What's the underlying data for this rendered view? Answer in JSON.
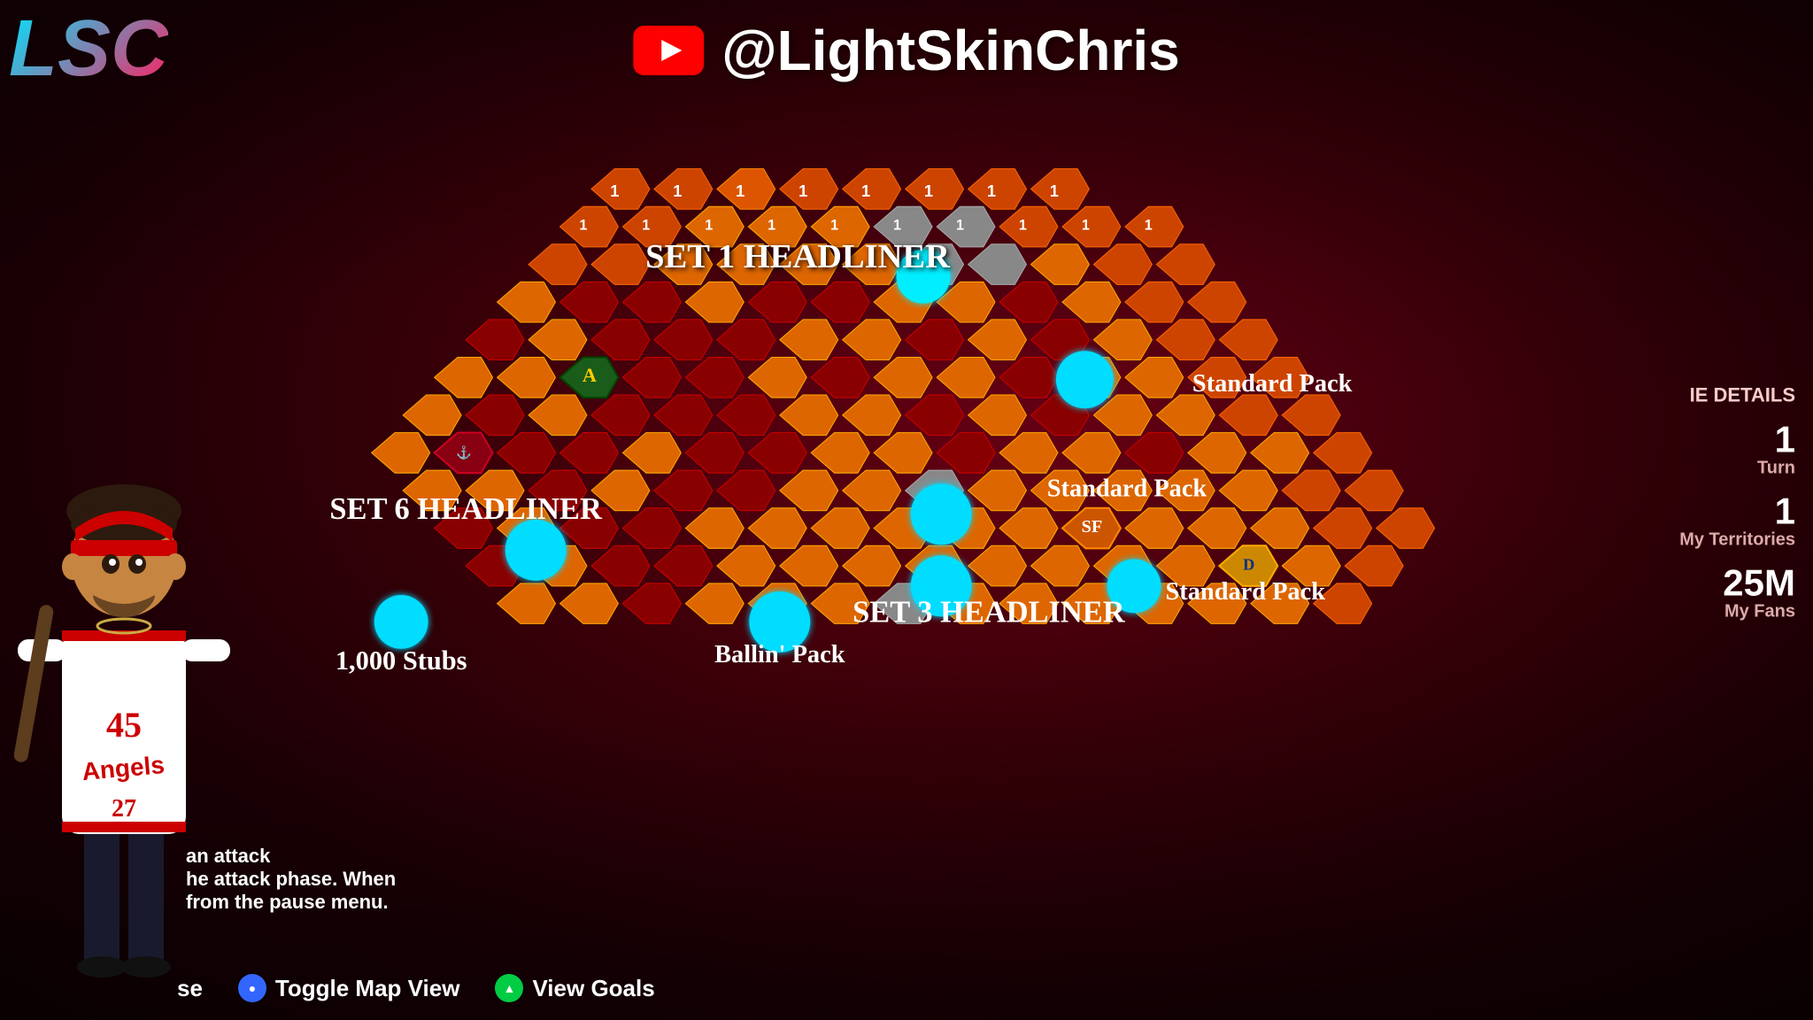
{
  "logo": {
    "text": "LSC"
  },
  "header": {
    "youtube_icon": "youtube",
    "channel": "@LightSkinChris"
  },
  "map": {
    "labels": {
      "set1_headliner": "SET 1 HEADLINER",
      "set3_headliner": "SET 3 HEADLINER",
      "set6_headliner": "SET 6 HEADLINER",
      "standard_pack_1": "Standard Pack",
      "standard_pack_2": "Standard Pack",
      "standard_pack_3": "Standard Pack",
      "ballin_pack": "Ballin' Pack",
      "stubs": "1,000 Stubs"
    },
    "team_badges": [
      "SF",
      "A",
      "D",
      "Angels"
    ],
    "hex_value": "1"
  },
  "right_panel": {
    "title": "IE DETAILS",
    "turn_label": "Turn",
    "turn_value": "1",
    "territories_label": "My Territories",
    "territories_value": "1",
    "fans_label": "My Fans",
    "fans_value": "25M"
  },
  "info_text": {
    "line1": "an attack",
    "line2": "he attack phase. When",
    "line3": "from the pause menu."
  },
  "bottom_bar": {
    "pause_label": "se",
    "toggle_label": "Toggle Map View",
    "goals_label": "View Goals",
    "toggle_icon": "circle",
    "goals_icon": "triangle"
  }
}
